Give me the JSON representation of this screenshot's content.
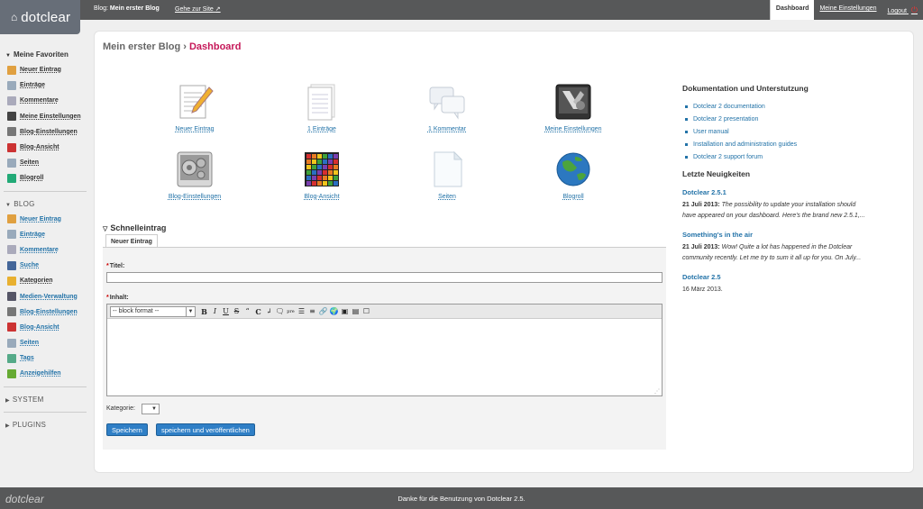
{
  "app": {
    "logo_text": "dotclear"
  },
  "topbar": {
    "blog_prefix": "Blog:",
    "blog_name": "Mein erster Blog",
    "site_link": "Gehe zur Site",
    "tabs": [
      "Dashboard",
      "Meine Einstellungen",
      "Logout"
    ]
  },
  "sidebar": {
    "favorites_title": "Meine Favoriten",
    "favorites": [
      {
        "label": "Neuer Eintrag",
        "icon": "pencil-icon",
        "color": "#e0a040"
      },
      {
        "label": "Einträge",
        "icon": "page-icon",
        "color": "#9ab"
      },
      {
        "label": "Kommentare",
        "icon": "comment-icon",
        "color": "#aab"
      },
      {
        "label": "Meine Einstellungen",
        "icon": "user-settings-icon",
        "color": "#444"
      },
      {
        "label": "Blog-Einstellungen",
        "icon": "gears-icon",
        "color": "#777"
      },
      {
        "label": "Blog-Ansicht",
        "icon": "palette-icon",
        "color": "#c33"
      },
      {
        "label": "Seiten",
        "icon": "page-icon",
        "color": "#9ab"
      },
      {
        "label": "Blogroll",
        "icon": "globe-icon",
        "color": "#2a7"
      }
    ],
    "blog_title": "BLOG",
    "blog_items": [
      {
        "label": "Neuer Eintrag",
        "icon": "pencil-icon",
        "color": "#e0a040"
      },
      {
        "label": "Einträge",
        "icon": "page-icon",
        "color": "#9ab"
      },
      {
        "label": "Kommentare",
        "icon": "comment-icon",
        "color": "#aab"
      },
      {
        "label": "Suche",
        "icon": "search-icon",
        "color": "#469"
      },
      {
        "label": "Kategorien",
        "icon": "folder-icon",
        "color": "#e8b030"
      },
      {
        "label": "Medien-Verwaltung",
        "icon": "media-icon",
        "color": "#556"
      },
      {
        "label": "Blog-Einstellungen",
        "icon": "gears-icon",
        "color": "#777"
      },
      {
        "label": "Blog-Ansicht",
        "icon": "palette-icon",
        "color": "#c33"
      },
      {
        "label": "Seiten",
        "icon": "page-icon",
        "color": "#9ab"
      },
      {
        "label": "Tags",
        "icon": "tag-icon",
        "color": "#5a8"
      },
      {
        "label": "Anzeigehilfen",
        "icon": "puzzle-icon",
        "color": "#6a3"
      }
    ],
    "system_title": "SYSTEM",
    "plugins_title": "PLUGINS"
  },
  "main": {
    "breadcrumb_blog": "Mein erster Blog",
    "breadcrumb_sep": " › ",
    "breadcrumb_current": "Dashboard",
    "icons": [
      {
        "label": "Neuer Eintrag",
        "icon": "new-entry-icon"
      },
      {
        "label": "1 Einträge",
        "icon": "entries-icon"
      },
      {
        "label": "1 Kommentar",
        "icon": "comments-icon"
      },
      {
        "label": "Meine Einstellungen",
        "icon": "prefs-icon"
      },
      {
        "label": "Blog-Einstellungen",
        "icon": "blog-settings-icon"
      },
      {
        "label": "Blog-Ansicht",
        "icon": "blog-theme-icon"
      },
      {
        "label": "Seiten",
        "icon": "pages-icon"
      },
      {
        "label": "Blogroll",
        "icon": "blogroll-icon"
      }
    ],
    "quick_entry": {
      "title": "Schnelleintrag",
      "tab": "Neuer Eintrag",
      "title_label": "Titel:",
      "content_label": "Inhalt:",
      "format_select": "-- block format --",
      "category_label": "Kategorie:",
      "save_button": "Speichern",
      "publish_button": "speichern und veröffentlichen",
      "required_mark": "*"
    }
  },
  "right": {
    "docs_title": "Dokumentation und Unterstutzung",
    "docs_links": [
      "Dotclear 2 documentation",
      "Dotclear 2 presentation",
      "User manual",
      "Installation and administration guides",
      "Dotclear 2 support forum"
    ],
    "news_title": "Letzte Neuigkeiten",
    "news": [
      {
        "title": "Dotclear 2.5.1",
        "date": "21 Juli 2013:",
        "text_1": "The possibility to update your installation should",
        "text_2": "have appeared on your dashboard. Here's the brand new 2.5.1,..."
      },
      {
        "title": "Something's in the air",
        "date": "21 Juli 2013:",
        "text_1": "Wow! Quite a lot has happened in the Dotclear",
        "text_2": "community recently. Let me try to sum it all up for you. On July..."
      },
      {
        "title": "Dotclear 2.5",
        "date": "16 März 2013."
      }
    ]
  },
  "footer": {
    "text": "Danke für die Benutzung von Dotclear 2.5.",
    "logo": "dotclear"
  }
}
